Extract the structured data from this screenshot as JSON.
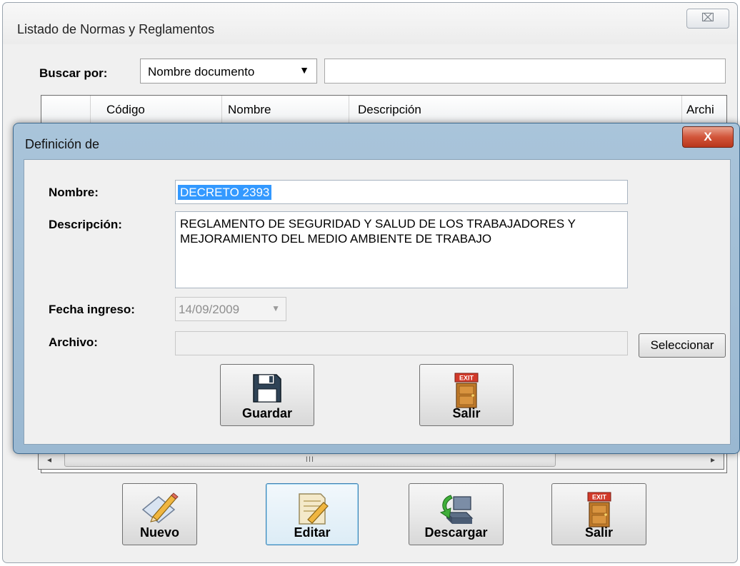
{
  "main_window": {
    "title": "Listado de Normas y Reglamentos",
    "close_glyph": "⌧",
    "search": {
      "label": "Buscar por:",
      "selected_option": "Nombre documento",
      "dropdown_arrow": "▼",
      "input_value": ""
    },
    "grid": {
      "columns": [
        "Código",
        "Nombre",
        "Descripción",
        "Archi"
      ],
      "scroll_left": "◂",
      "scroll_right": "▸",
      "scroll_thumb_grip": "III"
    },
    "buttons": {
      "new": "Nuevo",
      "edit": "Editar",
      "download": "Descargar",
      "exit": "Salir"
    }
  },
  "dialog": {
    "title": "Definición de",
    "close_glyph": "X",
    "fields": {
      "name_label": "Nombre:",
      "name_value": "DECRETO 2393",
      "description_label": "Descripción:",
      "description_value": "REGLAMENTO DE SEGURIDAD Y SALUD DE LOS TRABAJADORES Y MEJORAMIENTO DEL MEDIO AMBIENTE DE TRABAJO",
      "date_label": "Fecha ingreso:",
      "date_value": "14/09/2009",
      "date_arrow": "▼",
      "file_label": "Archivo:",
      "file_value": "",
      "select_button": "Seleccionar"
    },
    "buttons": {
      "save": "Guardar",
      "exit": "Salir"
    },
    "icons": {
      "save": "floppy-disk-icon",
      "exit": "exit-door-icon",
      "exit_sign_text": "EXIT"
    }
  },
  "colors": {
    "dialog_frame": "#9ab8d1",
    "selection": "#3399ff",
    "close_red": "#d2553a"
  }
}
